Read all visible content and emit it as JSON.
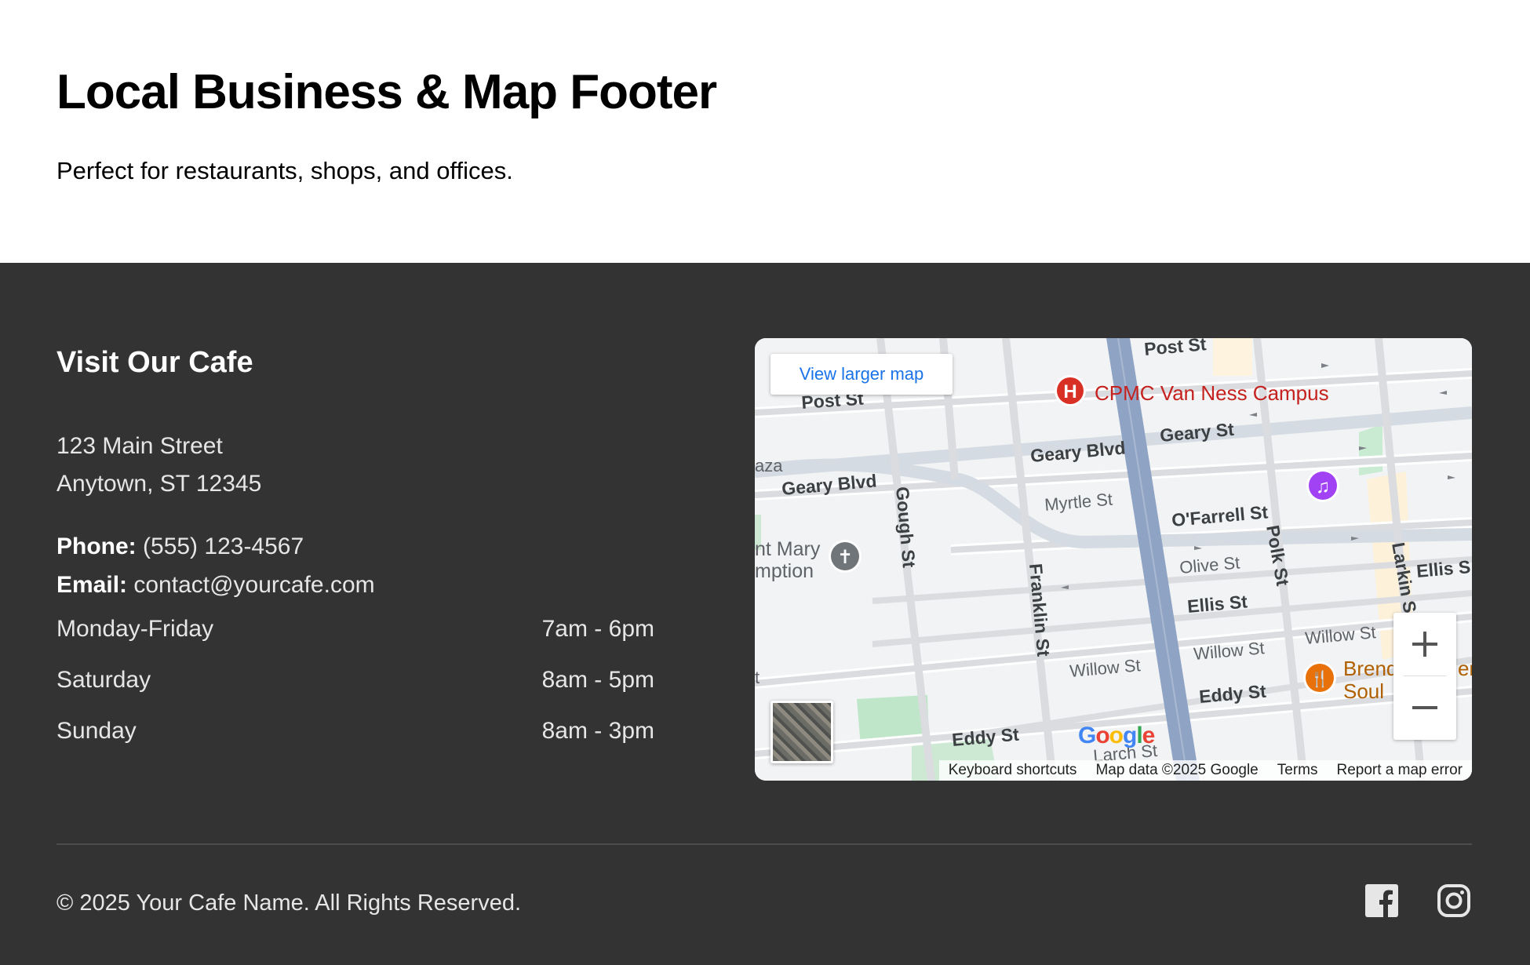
{
  "hero": {
    "title": "Local Business & Map Footer",
    "subtitle": "Perfect for restaurants, shops, and offices."
  },
  "footer": {
    "heading": "Visit Our Cafe",
    "address_line1": "123 Main Street",
    "address_line2": "Anytown, ST 12345",
    "phone_label": "Phone:",
    "phone": "(555) 123-4567",
    "email_label": "Email:",
    "email": "contact@yourcafe.com",
    "hours": [
      {
        "day": "Monday-Friday",
        "time": "7am - 6pm"
      },
      {
        "day": "Saturday",
        "time": "8am - 5pm"
      },
      {
        "day": "Sunday",
        "time": "8am - 3pm"
      }
    ],
    "copyright": "© 2025 Your Cafe Name. All Rights Reserved.",
    "social": [
      "facebook-icon",
      "instagram-icon"
    ]
  },
  "map": {
    "view_larger": "View larger map",
    "google_logo": "Google",
    "attribution": {
      "keyboard": "Keyboard shortcuts",
      "data": "Map data ©2025 Google",
      "terms": "Terms",
      "report": "Report a map error"
    },
    "streets": {
      "post_st_1": "Post St",
      "post_st_2": "Post St",
      "geary_blvd_1": "Geary Blvd",
      "geary_blvd_2": "Geary Blvd",
      "geary_st": "Geary St",
      "myrtle_st": "Myrtle St",
      "ofarrell_st": "O'Farrell St",
      "olive_st": "Olive St",
      "ellis_st_1": "Ellis St",
      "ellis_st_2": "Ellis S",
      "willow_st_1": "Willow St",
      "willow_st_2": "Willow St",
      "willow_st_3": "Willow St",
      "eddy_st_1": "Eddy St",
      "eddy_st_2": "Eddy St",
      "larch_st": "Larch St",
      "gough_st": "Gough St",
      "franklin_st": "Franklin St",
      "polk_st": "Polk St",
      "larkin_st": "Larkin S",
      "plaza": "aza",
      "t_left": "t"
    },
    "places": {
      "hospital": "CPMC Van Ness Campus",
      "church_1": "nt Mary",
      "church_2": "mption",
      "restaurant_1": "Brend",
      "restaurant_2": "Soul",
      "restaurant_3": "er"
    },
    "colors": {
      "hospital": "#d93025",
      "music": "#a142f4",
      "restaurant": "#e8710a",
      "church": "#70757a",
      "vanness": "#8fa3c4"
    }
  }
}
